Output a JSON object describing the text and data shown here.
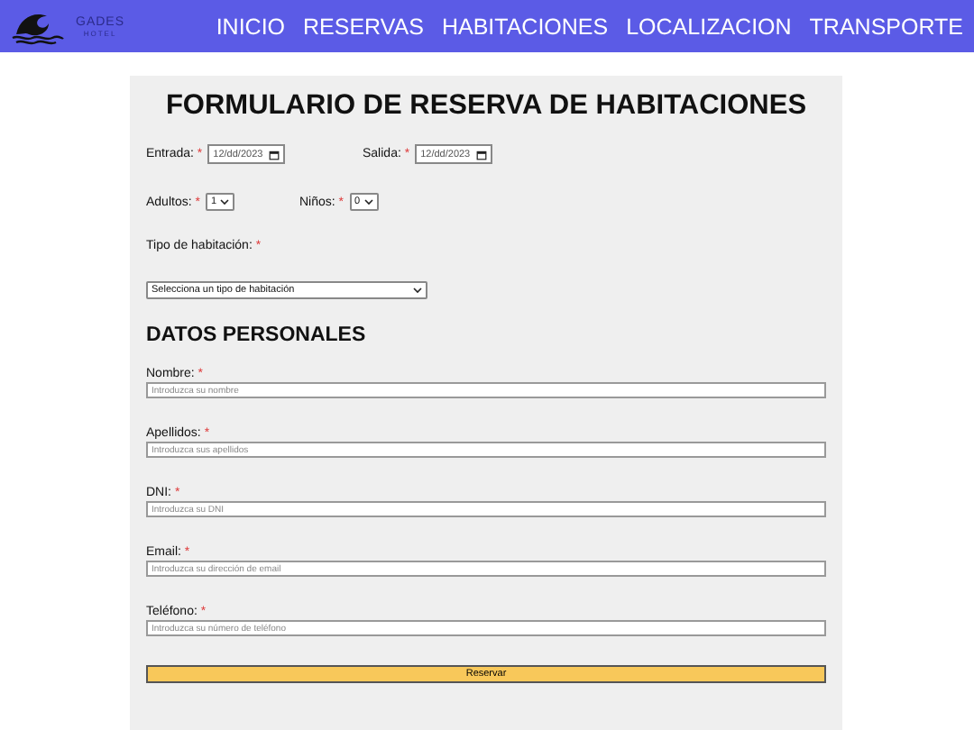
{
  "header": {
    "logo": {
      "name": "GADES",
      "subtitle": "HOTEL"
    },
    "nav": [
      "INICIO",
      "RESERVAS",
      "HABITACIONES",
      "LOCALIZACION",
      "TRANSPORTE"
    ]
  },
  "form": {
    "title": "FORMULARIO DE RESERVA DE HABITACIONES",
    "required_mark": "*",
    "dates": [
      {
        "label": "Entrada:",
        "value": "12/dd/2023"
      },
      {
        "label": "Salida:",
        "value": "12/dd/2023"
      }
    ],
    "counts": [
      {
        "label": "Adultos:",
        "value": "1"
      },
      {
        "label": "Niños:",
        "value": "0"
      }
    ],
    "room_type": {
      "label": "Tipo de habitación:",
      "value": "Selecciona un tipo de habitación"
    },
    "section_title": "DATOS PERSONALES",
    "fields": [
      {
        "label": "Nombre:",
        "placeholder": "Introduzca su nombre"
      },
      {
        "label": "Apellidos:",
        "placeholder": "Introduzca sus apellidos"
      },
      {
        "label": "DNI:",
        "placeholder": "Introduzca su DNI"
      },
      {
        "label": "Email:",
        "placeholder": "Introduzca su dirección de email"
      },
      {
        "label": "Teléfono:",
        "placeholder": "Introduzca su número de teléfono"
      }
    ],
    "submit": "Reservar"
  }
}
